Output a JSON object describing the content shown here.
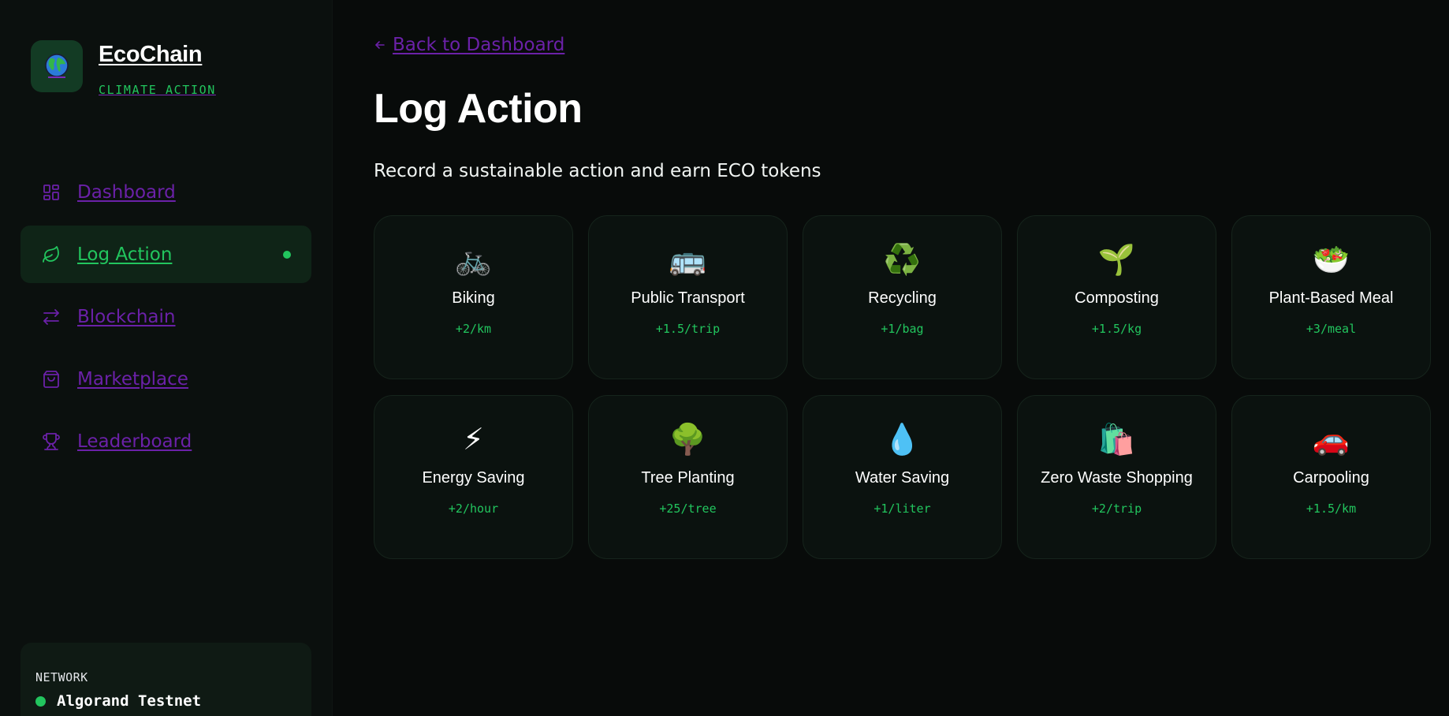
{
  "brand": {
    "title": "EcoChain",
    "subtitle": "CLIMATE ACTION",
    "logo_icon": "globe-icon"
  },
  "sidebar": {
    "items": [
      {
        "label": "Dashboard",
        "icon": "dashboard-icon",
        "active": false
      },
      {
        "label": "Log Action",
        "icon": "leaf-icon",
        "active": true
      },
      {
        "label": "Blockchain",
        "icon": "transfer-icon",
        "active": false
      },
      {
        "label": "Marketplace",
        "icon": "shopping-bag-icon",
        "active": false
      },
      {
        "label": "Leaderboard",
        "icon": "trophy-icon",
        "active": false
      }
    ],
    "network": {
      "label": "NETWORK",
      "value": "Algorand Testnet"
    }
  },
  "main": {
    "back_label": "Back to Dashboard",
    "title": "Log Action",
    "subtitle": "Record a sustainable action and earn ECO tokens",
    "actions": [
      {
        "icon": "🚲",
        "icon_name": "bicycle-icon",
        "name": "Biking",
        "reward": "+2/km"
      },
      {
        "icon": "🚌",
        "icon_name": "bus-icon",
        "name": "Public Transport",
        "reward": "+1.5/trip"
      },
      {
        "icon": "♻️",
        "icon_name": "recycle-icon",
        "name": "Recycling",
        "reward": "+1/bag"
      },
      {
        "icon": "🌱",
        "icon_name": "seedling-icon",
        "name": "Composting",
        "reward": "+1.5/kg"
      },
      {
        "icon": "🥗",
        "icon_name": "salad-icon",
        "name": "Plant-Based Meal",
        "reward": "+3/meal"
      },
      {
        "icon": "⚡",
        "icon_name": "lightning-icon",
        "name": "Energy Saving",
        "reward": "+2/hour"
      },
      {
        "icon": "🌳",
        "icon_name": "tree-icon",
        "name": "Tree Planting",
        "reward": "+25/tree"
      },
      {
        "icon": "💧",
        "icon_name": "droplet-icon",
        "name": "Water Saving",
        "reward": "+1/liter"
      },
      {
        "icon": "🛍️",
        "icon_name": "shopping-bags-icon",
        "name": "Zero Waste Shopping",
        "reward": "+2/trip"
      },
      {
        "icon": "🚗",
        "icon_name": "car-icon",
        "name": "Carpooling",
        "reward": "+1.5/km"
      }
    ]
  },
  "colors": {
    "accent": "#22c55e",
    "link": "#6b21a8",
    "background": "#080b0a",
    "sidebar": "#0b100e",
    "card": "#0b120f"
  }
}
